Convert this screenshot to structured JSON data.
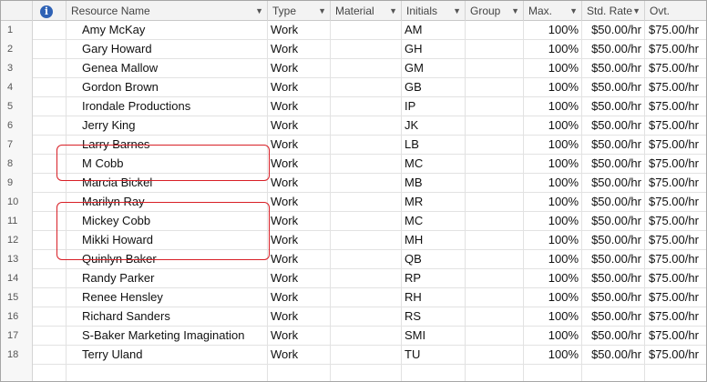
{
  "columns": {
    "num": "",
    "info": "i",
    "name": "Resource Name",
    "type": "Type",
    "material": "Material",
    "initials": "Initials",
    "group": "Group",
    "max": "Max.",
    "std_rate": "Std. Rate",
    "ovt": "Ovt."
  },
  "header_arrow": "▼",
  "rows": [
    {
      "num": "1",
      "name": "Amy McKay",
      "type": "Work",
      "material": "",
      "initials": "AM",
      "group": "",
      "max": "100%",
      "std_rate": "$50.00/hr",
      "ovt": "$75.00/hr"
    },
    {
      "num": "2",
      "name": "Gary Howard",
      "type": "Work",
      "material": "",
      "initials": "GH",
      "group": "",
      "max": "100%",
      "std_rate": "$50.00/hr",
      "ovt": "$75.00/hr"
    },
    {
      "num": "3",
      "name": "Genea Mallow",
      "type": "Work",
      "material": "",
      "initials": "GM",
      "group": "",
      "max": "100%",
      "std_rate": "$50.00/hr",
      "ovt": "$75.00/hr"
    },
    {
      "num": "4",
      "name": "Gordon Brown",
      "type": "Work",
      "material": "",
      "initials": "GB",
      "group": "",
      "max": "100%",
      "std_rate": "$50.00/hr",
      "ovt": "$75.00/hr"
    },
    {
      "num": "5",
      "name": "Irondale Productions",
      "type": "Work",
      "material": "",
      "initials": "IP",
      "group": "",
      "max": "100%",
      "std_rate": "$50.00/hr",
      "ovt": "$75.00/hr"
    },
    {
      "num": "6",
      "name": "Jerry King",
      "type": "Work",
      "material": "",
      "initials": "JK",
      "group": "",
      "max": "100%",
      "std_rate": "$50.00/hr",
      "ovt": "$75.00/hr"
    },
    {
      "num": "7",
      "name": "Larry Barnes",
      "type": "Work",
      "material": "",
      "initials": "LB",
      "group": "",
      "max": "100%",
      "std_rate": "$50.00/hr",
      "ovt": "$75.00/hr"
    },
    {
      "num": "8",
      "name": "M Cobb",
      "type": "Work",
      "material": "",
      "initials": "MC",
      "group": "",
      "max": "100%",
      "std_rate": "$50.00/hr",
      "ovt": "$75.00/hr"
    },
    {
      "num": "9",
      "name": "Marcia Bickel",
      "type": "Work",
      "material": "",
      "initials": "MB",
      "group": "",
      "max": "100%",
      "std_rate": "$50.00/hr",
      "ovt": "$75.00/hr"
    },
    {
      "num": "10",
      "name": "Marilyn Ray",
      "type": "Work",
      "material": "",
      "initials": "MR",
      "group": "",
      "max": "100%",
      "std_rate": "$50.00/hr",
      "ovt": "$75.00/hr"
    },
    {
      "num": "11",
      "name": "Mickey Cobb",
      "type": "Work",
      "material": "",
      "initials": "MC",
      "group": "",
      "max": "100%",
      "std_rate": "$50.00/hr",
      "ovt": "$75.00/hr"
    },
    {
      "num": "12",
      "name": "Mikki Howard",
      "type": "Work",
      "material": "",
      "initials": "MH",
      "group": "",
      "max": "100%",
      "std_rate": "$50.00/hr",
      "ovt": "$75.00/hr"
    },
    {
      "num": "13",
      "name": "Quinlyn Baker",
      "type": "Work",
      "material": "",
      "initials": "QB",
      "group": "",
      "max": "100%",
      "std_rate": "$50.00/hr",
      "ovt": "$75.00/hr"
    },
    {
      "num": "14",
      "name": "Randy Parker",
      "type": "Work",
      "material": "",
      "initials": "RP",
      "group": "",
      "max": "100%",
      "std_rate": "$50.00/hr",
      "ovt": "$75.00/hr"
    },
    {
      "num": "15",
      "name": "Renee Hensley",
      "type": "Work",
      "material": "",
      "initials": "RH",
      "group": "",
      "max": "100%",
      "std_rate": "$50.00/hr",
      "ovt": "$75.00/hr"
    },
    {
      "num": "16",
      "name": "Richard Sanders",
      "type": "Work",
      "material": "",
      "initials": "RS",
      "group": "",
      "max": "100%",
      "std_rate": "$50.00/hr",
      "ovt": "$75.00/hr"
    },
    {
      "num": "17",
      "name": "S-Baker Marketing Imagination",
      "type": "Work",
      "material": "",
      "initials": "SMI",
      "group": "",
      "max": "100%",
      "std_rate": "$50.00/hr",
      "ovt": "$75.00/hr"
    },
    {
      "num": "18",
      "name": "Terry Uland",
      "type": "Work",
      "material": "",
      "initials": "TU",
      "group": "",
      "max": "100%",
      "std_rate": "$50.00/hr",
      "ovt": "$75.00/hr"
    }
  ],
  "colors": {
    "highlight": "#d81f26",
    "info_icon": "#2f62b5"
  }
}
